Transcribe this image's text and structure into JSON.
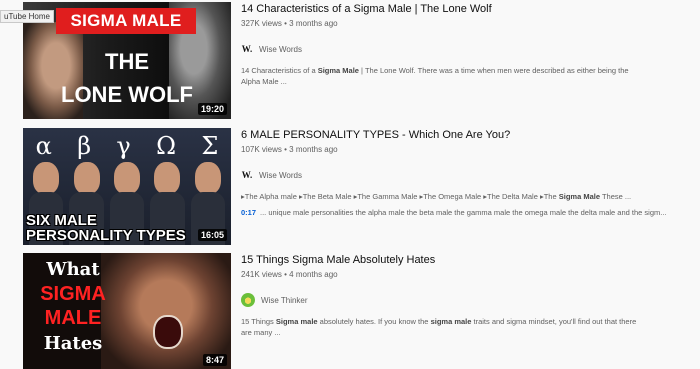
{
  "tooltip": "uTube Home",
  "results": [
    {
      "thumb_text": {
        "banner": "SIGMA MALE",
        "line1": "THE",
        "line2": "LONE WOLF"
      },
      "duration": "19:20",
      "title": "14 Characteristics of a Sigma Male | The Lone Wolf",
      "stats": "327K views • 3 months ago",
      "channel": {
        "logo": "W.",
        "name": "Wise Words"
      },
      "desc_pre": "14 Characteristics of a ",
      "desc_bold": "Sigma Male",
      "desc_post": " | The Lone Wolf. There was a time when men were described as either being the Alpha Male ..."
    },
    {
      "thumb_text": {
        "greek": [
          "α",
          "β",
          "γ",
          "Ω",
          "Σ"
        ],
        "line1": "SIX MALE",
        "line2": "PERSONALITY TYPES"
      },
      "duration": "16:05",
      "title": "6 MALE PERSONALITY TYPES - Which One Are You?",
      "stats": "107K views • 3 months ago",
      "channel": {
        "logo": "W.",
        "name": "Wise Words"
      },
      "chapters_pre": "▸The Alpha male ▸The Beta Male ▸The Gamma Male ▸The Omega Male ▸The Delta Male ▸The ",
      "chapters_bold": "Sigma Male",
      "chapters_post": " These ...",
      "key_moment": {
        "time": "0:17",
        "text": "... unique male personalities the alpha male the beta male the gamma male the omega male the delta male and the sigm..."
      }
    },
    {
      "thumb_text": {
        "line1": "What",
        "line2": "SIGMA",
        "line3": "MALE",
        "line4": "Hates"
      },
      "duration": "8:47",
      "title": "15 Things Sigma Male Absolutely Hates",
      "stats": "241K views • 4 months ago",
      "channel": {
        "name": "Wise Thinker"
      },
      "desc_a": "15 Things ",
      "desc_b": "Sigma male",
      "desc_c": " absolutely hates. If you know the ",
      "desc_d": "sigma male",
      "desc_e": " traits and sigma mindset, you'll find out that there are many ..."
    }
  ]
}
